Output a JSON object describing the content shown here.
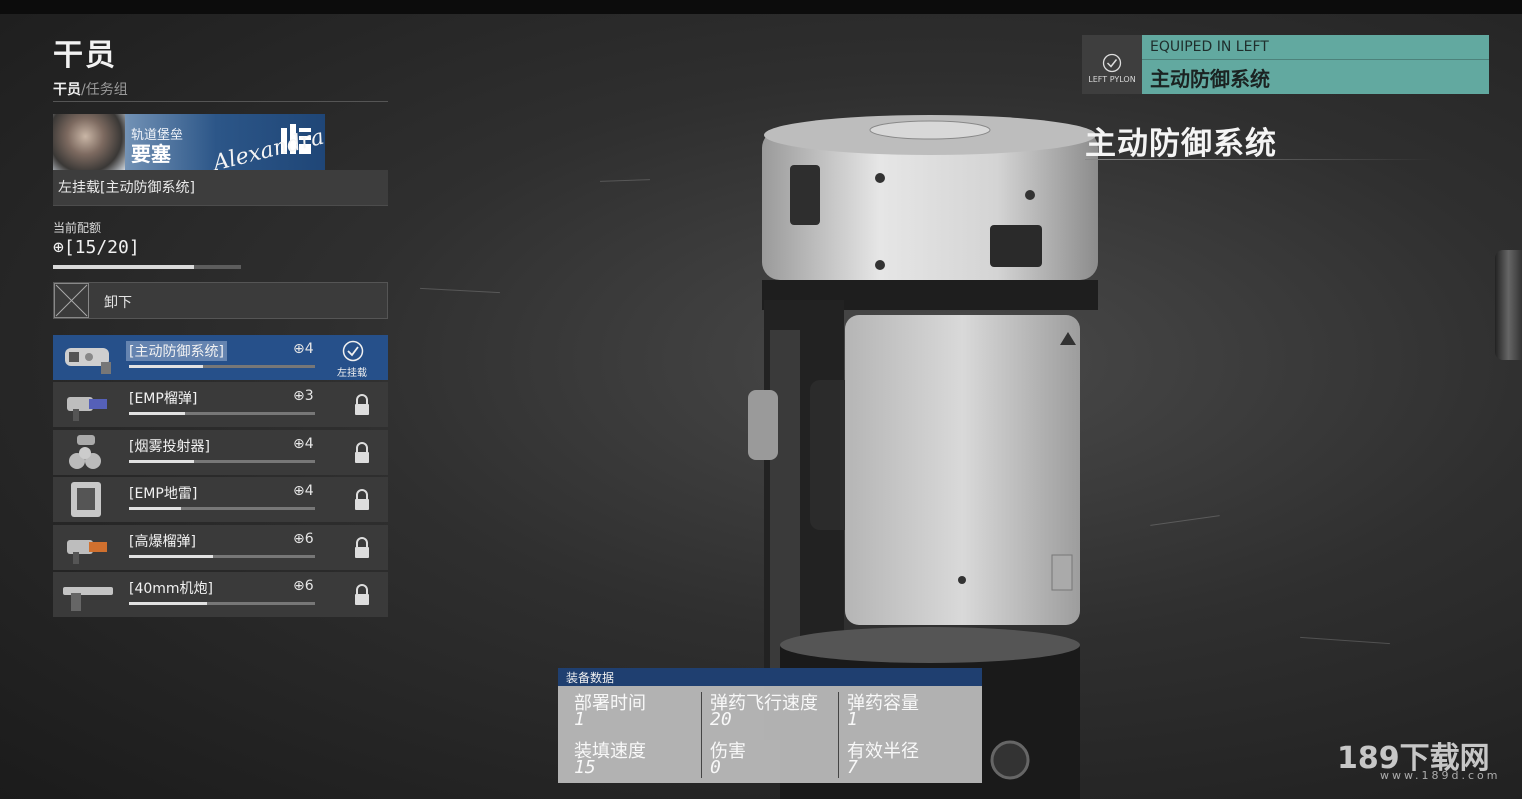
{
  "header": {
    "title": "干员",
    "breadcrumb_current": "干员",
    "breadcrumb_rest": "/任务组"
  },
  "character": {
    "subtitle": "轨道堡垒",
    "name": "要塞",
    "signature": "Alexandra"
  },
  "loadout_status": "左挂载[主动防御系统]",
  "quota": {
    "label": "当前配额",
    "value": "⊕[15/20]",
    "used": 15,
    "max": 20
  },
  "unequip": {
    "label": "卸下"
  },
  "equipment": [
    {
      "name": "[主动防御系统]",
      "cost": "⊕4",
      "selected": true,
      "locked": false,
      "equipped_tag": "左挂载",
      "icon": "defense-system-icon"
    },
    {
      "name": "[EMP榴弹]",
      "cost": "⊕3",
      "selected": false,
      "locked": true,
      "icon": "emp-grenade-icon"
    },
    {
      "name": "[烟雾投射器]",
      "cost": "⊕4",
      "selected": false,
      "locked": true,
      "icon": "smoke-launcher-icon"
    },
    {
      "name": "[EMP地雷]",
      "cost": "⊕4",
      "selected": false,
      "locked": true,
      "icon": "emp-mine-icon"
    },
    {
      "name": "[高爆榴弹]",
      "cost": "⊕6",
      "selected": false,
      "locked": true,
      "icon": "he-grenade-icon"
    },
    {
      "name": "[40mm机炮]",
      "cost": "⊕6",
      "selected": false,
      "locked": true,
      "icon": "autocannon-icon"
    }
  ],
  "equipped_badge": {
    "pylon_label": "LEFT PYLON",
    "status": "EQUIPED IN LEFT",
    "item": "主动防御系统"
  },
  "item_title": "主动防御系统",
  "stats": {
    "header": "装备数据",
    "items": [
      {
        "label": "部署时间",
        "value": "1"
      },
      {
        "label": "弹药飞行速度",
        "value": "20"
      },
      {
        "label": "弹药容量",
        "value": "1"
      },
      {
        "label": "装填速度",
        "value": "15"
      },
      {
        "label": "伤害",
        "value": "0"
      },
      {
        "label": "有效半径",
        "value": "7"
      }
    ]
  },
  "watermark": {
    "main": "189下载网",
    "sub": "www.189d.com"
  }
}
